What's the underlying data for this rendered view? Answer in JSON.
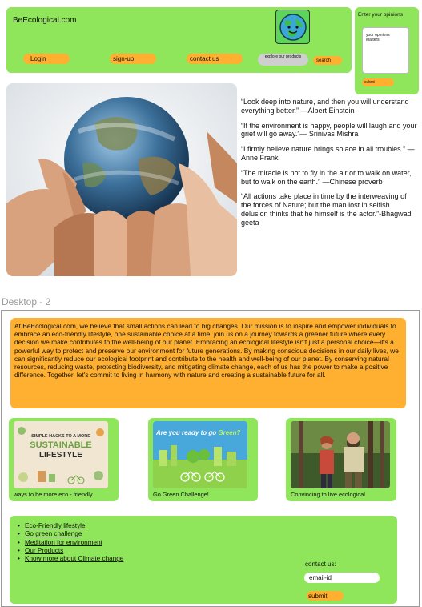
{
  "header": {
    "site_name": "BeEcological.com",
    "login": "Login",
    "signup": "sign-up",
    "contact": "contact us",
    "explore_placeholder": "explore our products",
    "search": "search"
  },
  "opinion": {
    "title": "Enter your opinions",
    "placeholder": "your opinions Matters!",
    "submit": "submi"
  },
  "quotes": [
    "“Look deep into nature, and then you will understand everything better.” —Albert Einstein",
    "“If the environment is happy, people will laugh and your grief will go away.”— Srinivas Mishra",
    "“I firmly believe nature brings solace in all troubles.” —Anne Frank",
    "“The miracle is not to fly in the air or to walk on water, but to walk on the earth.” —Chinese proverb",
    "“All actions take place in time by the interweaving of the forces of Nature; but the man lost in selfish delusion thinks that he himself is the actor.”-Bhagwad geeta"
  ],
  "frame_label": "Desktop - 2",
  "about": "At BeEcological.com, we believe that small actions can lead to big changes. Our mission is to inspire and empower individuals to embrace an eco-friendly lifestyle, one sustainable choice at a time. join us on a journey towards a greener future where every decision we make contributes to the well-being of our planet. Embracing an ecological lifestyle isn't just a personal choice—it's a powerful way to protect and preserve our environment for future generations. By making conscious decisions in our daily lives, we can significantly reduce our ecological footprint and contribute to the health and well-being of our planet. By conserving natural resources, reducing waste, protecting biodiversity, and mitigating climate change, each of us has the power to make a positive difference. Together, let's commit to living in harmony with nature and creating a sustainable future for all.",
  "cards": [
    {
      "caption": "ways to be more eco - friendly",
      "img_line1": "SIMPLE HACKS TO A MORE",
      "img_line2": "SUSTAINABLE",
      "img_line3": "LIFESTYLE"
    },
    {
      "caption": "Go Green Challenge!",
      "img_text_a": "Are you ready to go ",
      "img_text_b": "Green?"
    },
    {
      "caption": "Convincing to live ecological"
    }
  ],
  "footer": {
    "links": [
      "Eco-Friendly lifestyle",
      "Go green challenge",
      "Meditation for environment",
      "Our Products",
      "Know more about Climate change"
    ],
    "contact_label": "contact us:",
    "email_placeholder": "email-id",
    "submit": "submit"
  },
  "colors": {
    "green": "#8fe65a",
    "orange": "#ffb030"
  }
}
